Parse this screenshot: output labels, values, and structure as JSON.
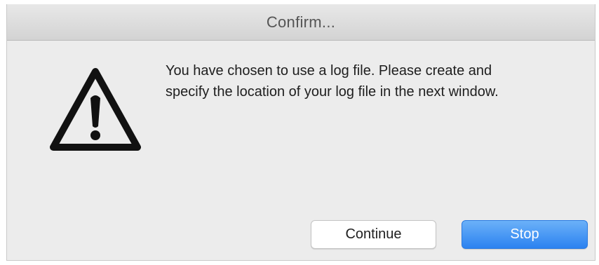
{
  "window": {
    "title": "Confirm..."
  },
  "dialog": {
    "icon": "warning-triangle-icon",
    "message_line1": "You have chosen to use a log file. Please create and",
    "message_line2": "specify the location of your log file in the next window."
  },
  "buttons": {
    "continue_label": "Continue",
    "stop_label": "Stop"
  },
  "colors": {
    "primary_button": "#2c82f0",
    "dialog_background": "#ececec"
  }
}
